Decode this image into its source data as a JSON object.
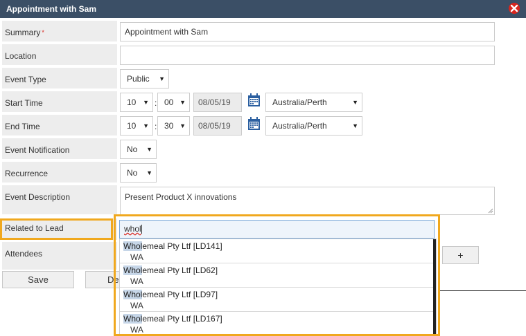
{
  "window": {
    "title": "Appointment with Sam"
  },
  "labels": {
    "summary": "Summary",
    "location": "Location",
    "event_type": "Event Type",
    "start_time": "Start Time",
    "end_time": "End Time",
    "event_notification": "Event Notification",
    "recurrence": "Recurrence",
    "event_description": "Event Description",
    "related_to_lead": "Related to Lead",
    "attendees": "Attendees"
  },
  "required_marker": "*",
  "fields": {
    "summary": "Appointment with Sam",
    "location": "",
    "event_type": "Public",
    "start_hour": "10",
    "start_minute": "00",
    "start_date": "08/05/19",
    "start_timezone": "Australia/Perth",
    "end_hour": "10",
    "end_minute": "30",
    "end_date": "08/05/19",
    "end_timezone": "Australia/Perth",
    "event_notification": "No",
    "recurrence": "No",
    "event_description": "Present Product X innovations",
    "related_to_lead": "whol"
  },
  "time_separator": ":",
  "dropdown_match": "Whol",
  "suggestions": [
    {
      "rest": "emeal Pty Ltf [LD141]",
      "sub": "WA"
    },
    {
      "rest": "emeal Pty Ltf [LD62]",
      "sub": "WA"
    },
    {
      "rest": "emeal Pty Ltf [LD97]",
      "sub": "WA"
    },
    {
      "rest": "emeal Pty Ltf [LD167]",
      "sub": "WA"
    }
  ],
  "buttons": {
    "save": "Save",
    "delete_partial": "De",
    "add_attendee": "+"
  },
  "icons": {
    "close": "close-icon",
    "calendar": "calendar-icon",
    "dropdown_arrow": "▼"
  },
  "colors": {
    "titlebar": "#3b4f66",
    "highlight": "#f0a81e",
    "close": "#d9251d"
  }
}
